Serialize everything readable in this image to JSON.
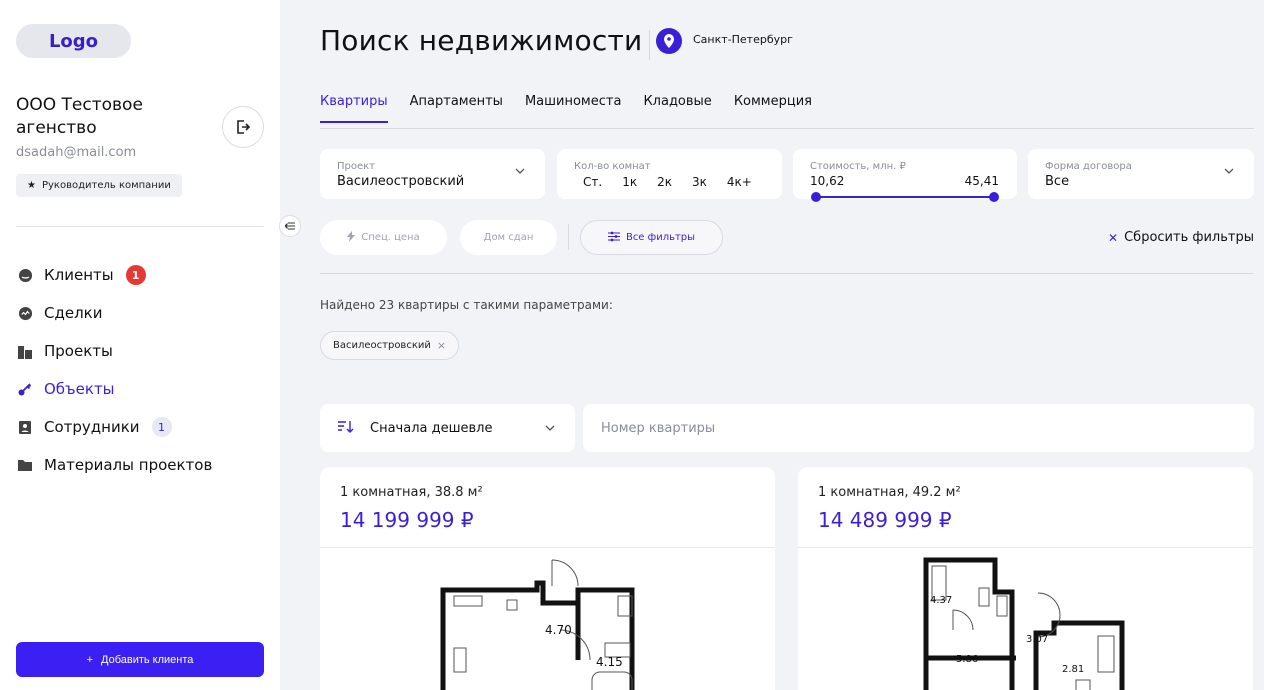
{
  "sidebar": {
    "logo": "Logo",
    "agency_name": "ООО Тестовое агенство",
    "email": "dsadah@mail.com",
    "role": "Руководитель компании",
    "nav": [
      {
        "label": "Клиенты",
        "badge": "1",
        "icon": "user-circle-icon"
      },
      {
        "label": "Сделки",
        "icon": "handshake-icon"
      },
      {
        "label": "Проекты",
        "icon": "buildings-icon"
      },
      {
        "label": "Объекты",
        "icon": "key-icon",
        "active": true
      },
      {
        "label": "Сотрудники",
        "badge": "1",
        "icon": "id-card-icon"
      },
      {
        "label": "Материалы проектов",
        "icon": "folder-icon"
      }
    ],
    "add_client": "Добавить клиента"
  },
  "header": {
    "title": "Поиск недвижимости",
    "city": "Санкт-Петербург"
  },
  "tabs": [
    {
      "label": "Квартиры",
      "active": true
    },
    {
      "label": "Апартаменты"
    },
    {
      "label": "Машиноместа"
    },
    {
      "label": "Кладовые"
    },
    {
      "label": "Коммерция"
    }
  ],
  "filters": {
    "project": {
      "label": "Проект",
      "value": "Василеостровский"
    },
    "rooms": {
      "label": "Кол-во комнат",
      "options": [
        "Ст.",
        "1к",
        "2к",
        "3к",
        "4к+"
      ]
    },
    "price": {
      "label": "Стоимость, млн. ₽",
      "min": "10,62",
      "max": "45,41"
    },
    "contract": {
      "label": "Форма договора",
      "value": "Все"
    },
    "special_price": "Спец. цена",
    "house_ready": "Дом сдан",
    "all_filters": "Все фильтры",
    "reset": "Сбросить фильтры"
  },
  "results": {
    "found_text": "Найдено 23 квартиры с такими параметрами:",
    "tag": "Василеостровский",
    "sort": "Сначала дешевле",
    "search_placeholder": "Номер квартиры"
  },
  "cards": [
    {
      "type": "1 комнатная, 38.8 м²",
      "price": "14 199 999 ₽",
      "areas": [
        "4.70",
        "4.15"
      ]
    },
    {
      "type": "1 комнатная, 49.2 м²",
      "price": "14 489 999 ₽",
      "areas": [
        "4.37",
        "3.07",
        "5.86",
        "2.81"
      ]
    }
  ],
  "colors": {
    "accent": "#3b1fd6",
    "button": "#3b1ff3",
    "badge_red": "#e53935",
    "background": "#f2f3f7"
  }
}
